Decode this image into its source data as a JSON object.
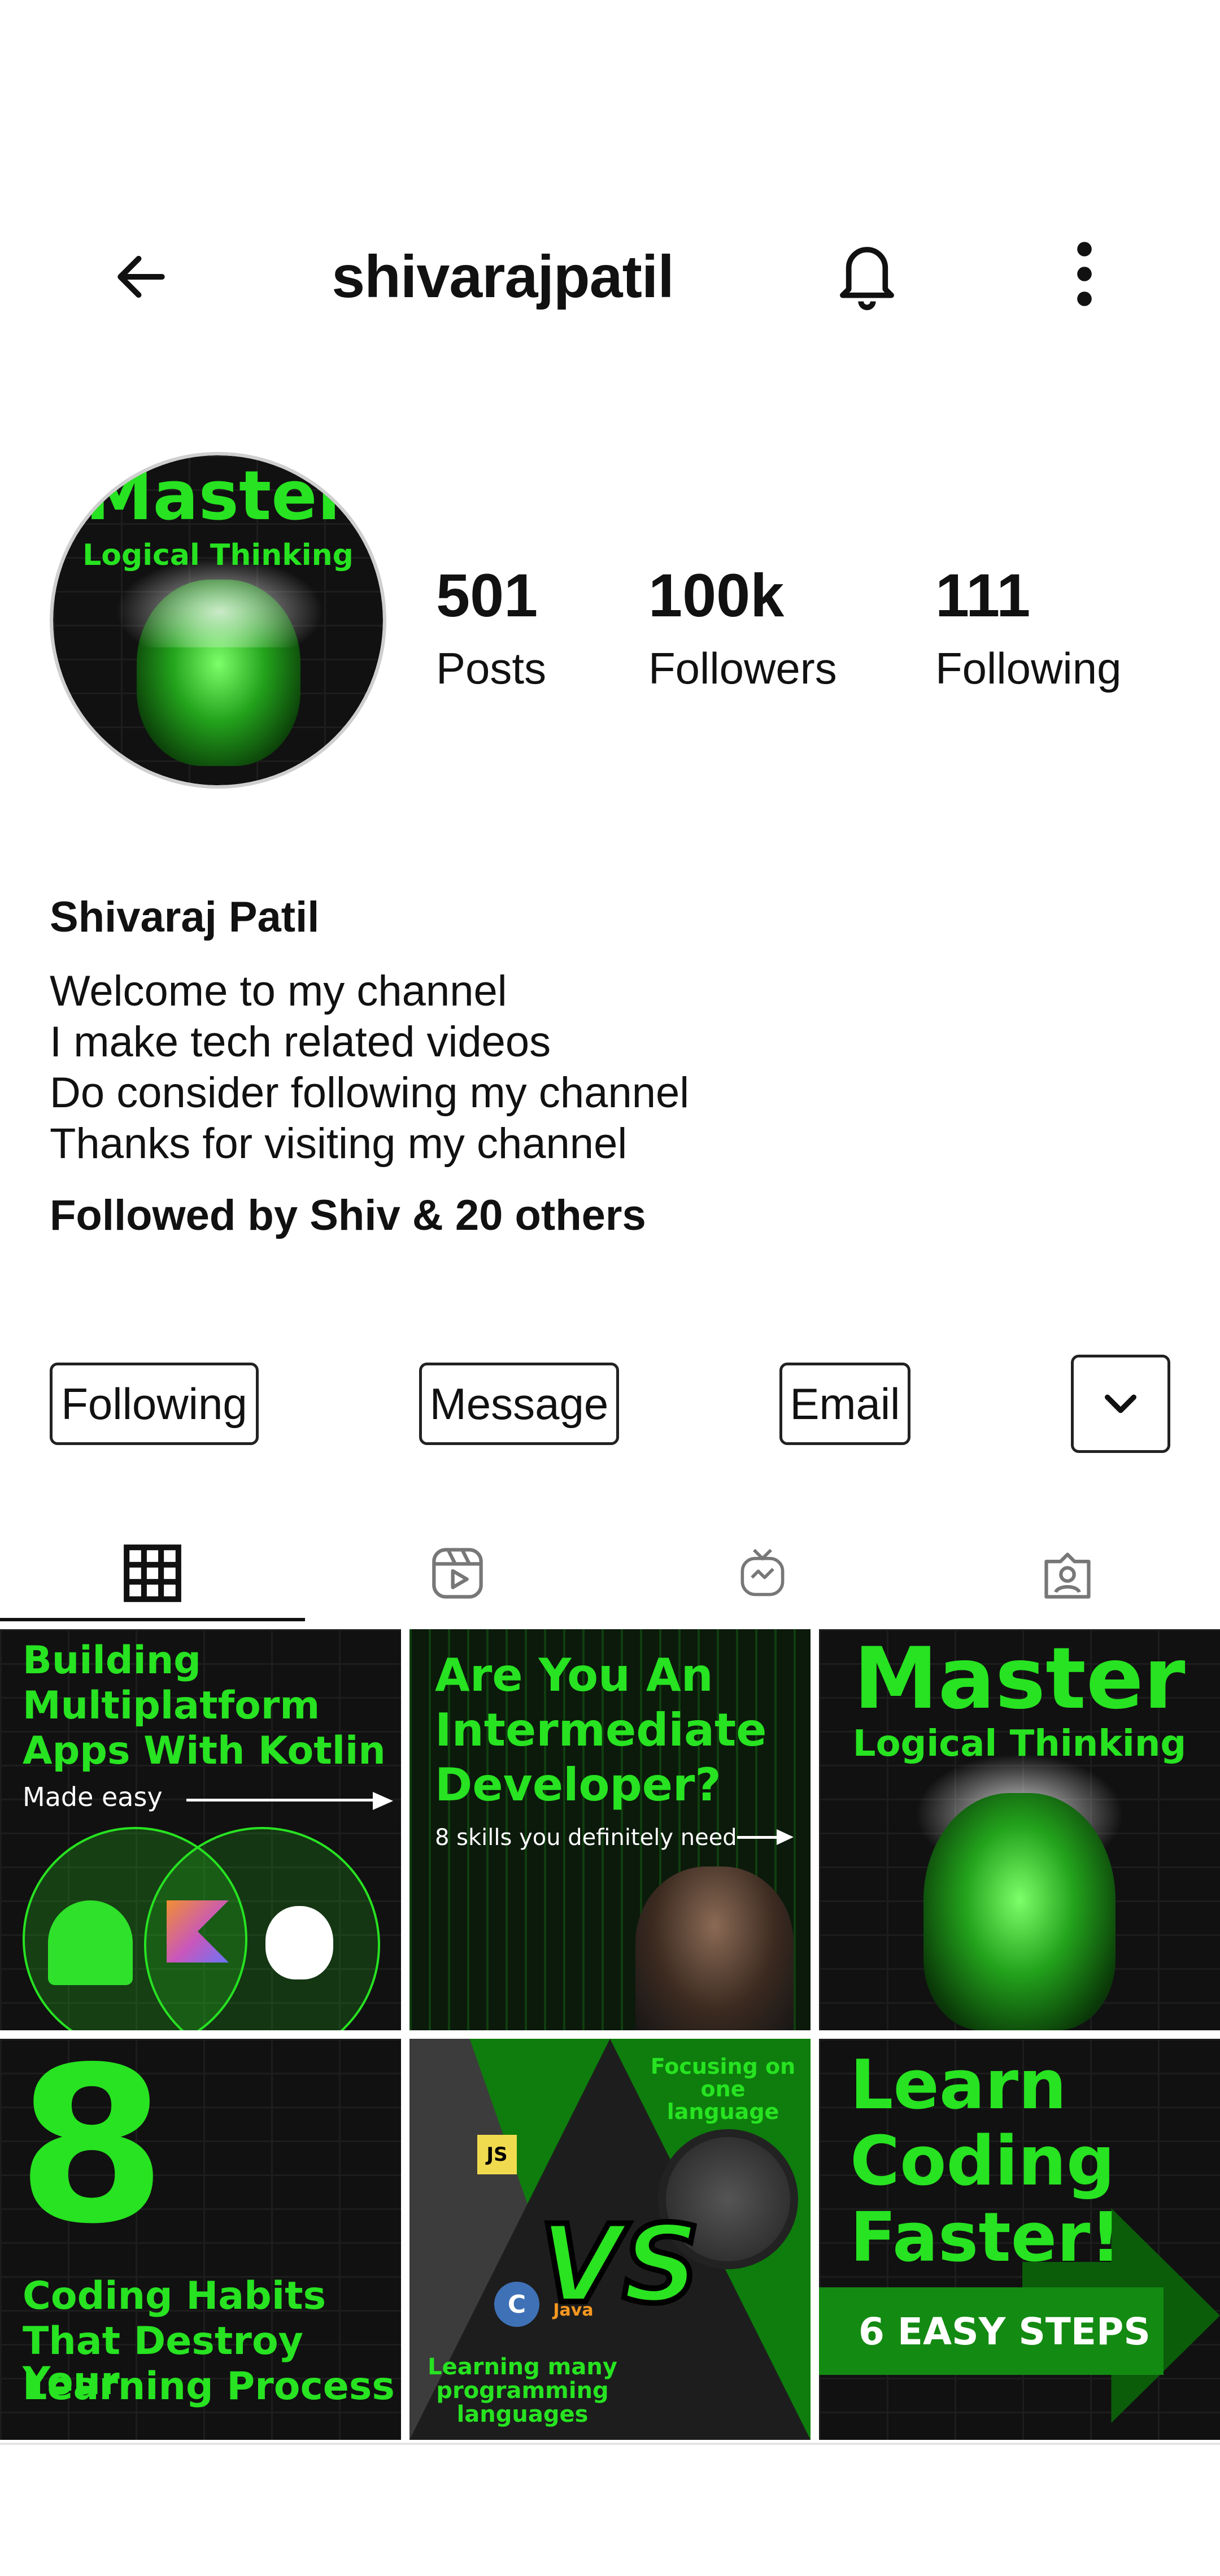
{
  "header": {
    "username": "shivarajpatil",
    "back_icon": "arrow-left-icon",
    "bell_icon": "bell-icon",
    "more_icon": "more-vertical-icon"
  },
  "profile": {
    "avatar_text_line1": "Master",
    "avatar_text_line2": "Logical Thinking",
    "stats": [
      {
        "value": "501",
        "label": "Posts"
      },
      {
        "value": "100k",
        "label": "Followers"
      },
      {
        "value": "111",
        "label": "Following"
      }
    ],
    "name": "Shivaraj Patil",
    "bio": [
      "Welcome to my channel",
      "I make tech related videos",
      "Do consider following my channel",
      "Thanks for visiting my channel"
    ],
    "followed_by": "Followed by Shiv & 20 others"
  },
  "actions": {
    "following": "Following",
    "message": "Message",
    "email": "Email",
    "dropdown_icon": "chevron-down-icon"
  },
  "tabs": [
    {
      "icon": "grid-icon",
      "active": true
    },
    {
      "icon": "reels-icon",
      "active": false
    },
    {
      "icon": "igtv-icon",
      "active": false
    },
    {
      "icon": "tagged-icon",
      "active": false
    }
  ],
  "posts": [
    {
      "lines": [
        "Building",
        "Multiplatform",
        "Apps With Kotlin"
      ],
      "sub": "Made easy"
    },
    {
      "lines": [
        "Are You An",
        "Intermediate",
        "Developer?"
      ],
      "sub": "8 skills you definitely need"
    },
    {
      "lines": [
        "Master"
      ],
      "sub": "Logical Thinking"
    },
    {
      "big": "8",
      "lines": [
        "Coding Habits",
        "That Destroy Your",
        "Learning Process"
      ]
    },
    {
      "top": "Focusing on one language",
      "vs": "VS",
      "bottom": "Learning many programming languages",
      "tags": [
        "JS",
        "C",
        "Java"
      ]
    },
    {
      "lines": [
        "Learn",
        "Coding",
        "Faster!"
      ],
      "sub": "6 EASY STEPS"
    }
  ],
  "colors": {
    "accent_green": "#27e321",
    "text": "#111111",
    "border": "#222222"
  }
}
